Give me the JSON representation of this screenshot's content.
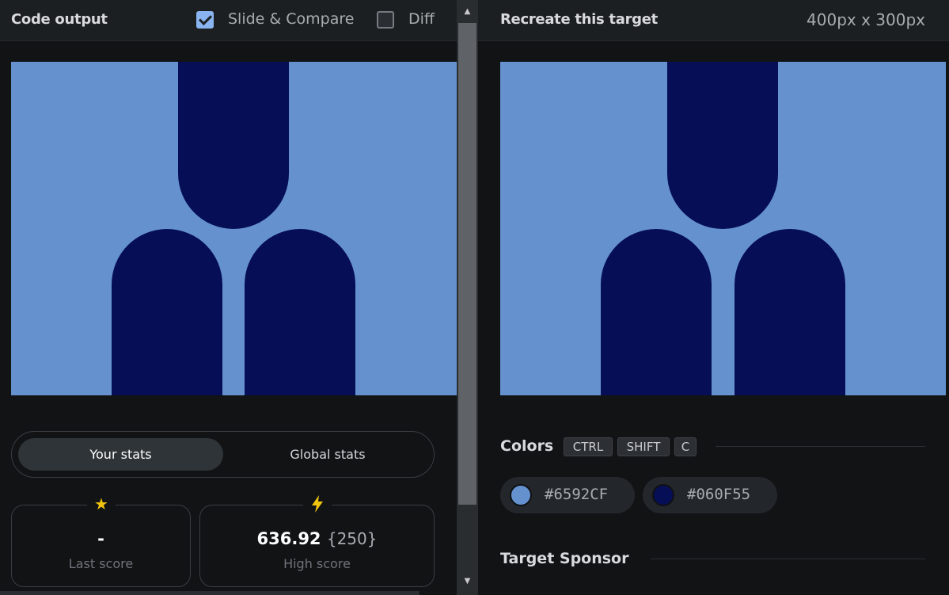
{
  "left_panel": {
    "title": "Code output",
    "slide_compare": {
      "label": "Slide & Compare",
      "checked": true
    },
    "diff": {
      "label": "Diff",
      "checked": false
    },
    "tabs": {
      "your_stats": "Your stats",
      "global_stats": "Global stats",
      "active": "your_stats"
    },
    "last_score": {
      "icon": "star-icon",
      "value": "-",
      "label": "Last score"
    },
    "high_score": {
      "icon": "lightning-icon",
      "value": "636.92",
      "extra": "{250}",
      "label": "High score"
    }
  },
  "right_panel": {
    "title": "Recreate this target",
    "size": "400px x 300px",
    "colors": {
      "title": "Colors",
      "shortcut": [
        "CTRL",
        "SHIFT",
        "C"
      ],
      "swatches": [
        {
          "hex": "#6592CF",
          "label": "#6592CF"
        },
        {
          "hex": "#060F55",
          "label": "#060F55"
        }
      ]
    },
    "sponsor_title": "Target Sponsor"
  },
  "theme": {
    "background": "#6592CF",
    "shape": "#060F55",
    "accent": "#8ab4f0"
  }
}
